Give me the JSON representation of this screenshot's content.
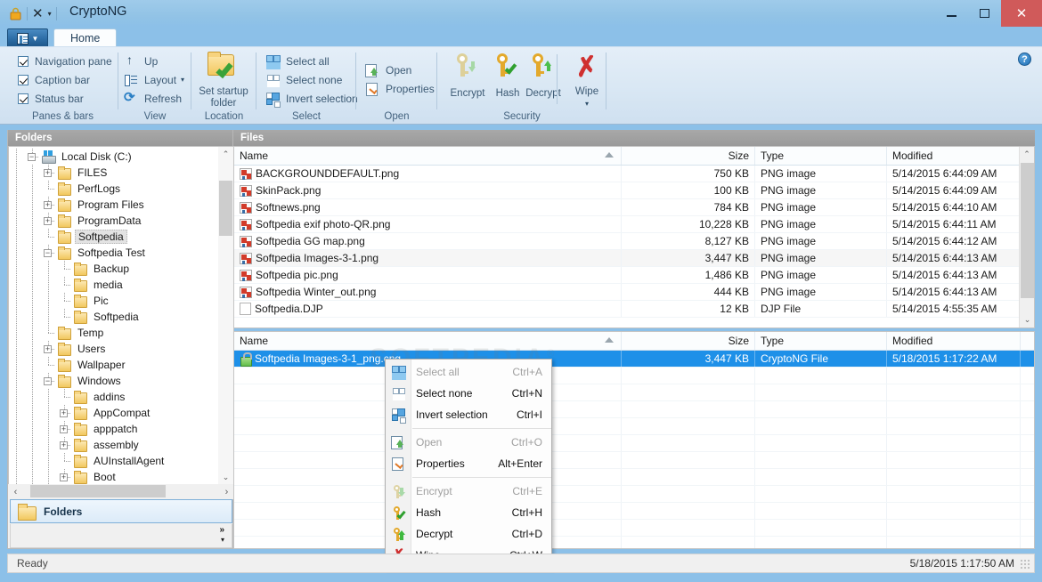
{
  "window": {
    "title": "CryptoNG",
    "qat": {
      "lock_icon": "lock-icon",
      "close_icon": "close-icon",
      "caret": "▾"
    },
    "buttons": {
      "minimize": "minimize-button",
      "maximize": "maximize-button",
      "close": "✕"
    }
  },
  "ribbon": {
    "app_button": "app-menu-button",
    "tab": "Home",
    "help": "?",
    "groups": [
      {
        "label": "Panes & bars"
      },
      {
        "label": "View"
      },
      {
        "label": "Location"
      },
      {
        "label": "Select"
      },
      {
        "label": "Open"
      },
      {
        "label": "Security"
      }
    ],
    "panes_bars": [
      {
        "label": "Navigation pane",
        "checked": true
      },
      {
        "label": "Caption bar",
        "checked": true
      },
      {
        "label": "Status bar",
        "checked": true
      }
    ],
    "view": [
      {
        "label": "Up",
        "icon": "arrow-up-icon"
      },
      {
        "label": "Layout",
        "icon": "layout-icon",
        "caret": "▾"
      },
      {
        "label": "Refresh",
        "icon": "refresh-icon"
      }
    ],
    "location": {
      "label_line1": "Set startup",
      "label_line2": "folder",
      "icon": "folder-check-icon"
    },
    "select": [
      {
        "label": "Select all",
        "icon": "select-all-icon"
      },
      {
        "label": "Select none",
        "icon": "select-none-icon"
      },
      {
        "label": "Invert selection",
        "icon": "invert-selection-icon"
      }
    ],
    "open": [
      {
        "label": "Open",
        "icon": "open-file-icon"
      },
      {
        "label": "Properties",
        "icon": "properties-icon"
      }
    ],
    "security": [
      {
        "label": "Encrypt",
        "icon": "key-down-icon"
      },
      {
        "label": "Hash",
        "icon": "key-check-icon"
      },
      {
        "label": "Decrypt",
        "icon": "key-up-icon"
      },
      {
        "label": "Wipe",
        "icon": "red-x-icon",
        "caret": "▾"
      }
    ]
  },
  "folders_pane": {
    "header": "Folders",
    "tree": [
      {
        "label": "Local Disk (C:)",
        "depth": 2,
        "expander": "minus",
        "icon": "drive-icon",
        "selected": false
      },
      {
        "label": "FILES",
        "depth": 3,
        "expander": "plus",
        "icon": "folder-icon",
        "selected": false
      },
      {
        "label": "PerfLogs",
        "depth": 3,
        "expander": "none",
        "icon": "folder-icon",
        "selected": false
      },
      {
        "label": "Program Files",
        "depth": 3,
        "expander": "plus",
        "icon": "folder-icon",
        "selected": false
      },
      {
        "label": "ProgramData",
        "depth": 3,
        "expander": "plus",
        "icon": "folder-icon",
        "selected": false
      },
      {
        "label": "Softpedia",
        "depth": 3,
        "expander": "none",
        "icon": "folder-icon",
        "selected": true
      },
      {
        "label": "Softpedia Test",
        "depth": 3,
        "expander": "minus",
        "icon": "folder-icon",
        "selected": false
      },
      {
        "label": "Backup",
        "depth": 4,
        "expander": "none",
        "icon": "folder-icon",
        "selected": false
      },
      {
        "label": "media",
        "depth": 4,
        "expander": "none",
        "icon": "folder-icon",
        "selected": false
      },
      {
        "label": "Pic",
        "depth": 4,
        "expander": "none",
        "icon": "folder-icon",
        "selected": false
      },
      {
        "label": "Softpedia",
        "depth": 4,
        "expander": "none",
        "icon": "folder-icon",
        "selected": false
      },
      {
        "label": "Temp",
        "depth": 3,
        "expander": "none",
        "icon": "folder-icon",
        "selected": false
      },
      {
        "label": "Users",
        "depth": 3,
        "expander": "plus",
        "icon": "folder-icon",
        "selected": false
      },
      {
        "label": "Wallpaper",
        "depth": 3,
        "expander": "none",
        "icon": "folder-icon",
        "selected": false
      },
      {
        "label": "Windows",
        "depth": 3,
        "expander": "minus",
        "icon": "folder-icon",
        "selected": false
      },
      {
        "label": "addins",
        "depth": 4,
        "expander": "none",
        "icon": "folder-icon",
        "selected": false
      },
      {
        "label": "AppCompat",
        "depth": 4,
        "expander": "plus",
        "icon": "folder-icon",
        "selected": false
      },
      {
        "label": "apppatch",
        "depth": 4,
        "expander": "plus",
        "icon": "folder-icon",
        "selected": false
      },
      {
        "label": "assembly",
        "depth": 4,
        "expander": "plus",
        "icon": "folder-icon",
        "selected": false
      },
      {
        "label": "AUInstallAgent",
        "depth": 4,
        "expander": "none",
        "icon": "folder-icon",
        "selected": false
      },
      {
        "label": "Boot",
        "depth": 4,
        "expander": "plus",
        "icon": "folder-icon",
        "selected": false
      }
    ],
    "folders_button": "Folders",
    "overflow_chevron": "»",
    "overflow_caret": "▾",
    "hscroll_left": "‹",
    "hscroll_right": "›"
  },
  "files_pane": {
    "header": "Files",
    "columns": [
      "Name",
      "Size",
      "Type",
      "Modified"
    ],
    "sorted_by": "Name",
    "sort_direction": "ascending",
    "rows": [
      {
        "name": "BACKGROUNDDEFAULT.png",
        "size": "750 KB",
        "type": "PNG image",
        "modified": "5/14/2015 6:44:09 AM",
        "icon": "png-file-icon"
      },
      {
        "name": "SkinPack.png",
        "size": "100 KB",
        "type": "PNG image",
        "modified": "5/14/2015 6:44:09 AM",
        "icon": "png-file-icon"
      },
      {
        "name": "Softnews.png",
        "size": "784 KB",
        "type": "PNG image",
        "modified": "5/14/2015 6:44:10 AM",
        "icon": "png-file-icon"
      },
      {
        "name": "Softpedia exif photo-QR.png",
        "size": "10,228 KB",
        "type": "PNG image",
        "modified": "5/14/2015 6:44:11 AM",
        "icon": "png-file-icon"
      },
      {
        "name": "Softpedia GG map.png",
        "size": "8,127 KB",
        "type": "PNG image",
        "modified": "5/14/2015 6:44:12 AM",
        "icon": "png-file-icon"
      },
      {
        "name": "Softpedia Images-3-1.png",
        "size": "3,447 KB",
        "type": "PNG image",
        "modified": "5/14/2015 6:44:13 AM",
        "icon": "png-file-icon",
        "highlight": true
      },
      {
        "name": "Softpedia pic.png",
        "size": "1,486 KB",
        "type": "PNG image",
        "modified": "5/14/2015 6:44:13 AM",
        "icon": "png-file-icon"
      },
      {
        "name": "Softpedia Winter_out.png",
        "size": "444 KB",
        "type": "PNG image",
        "modified": "5/14/2015 6:44:13 AM",
        "icon": "png-file-icon"
      },
      {
        "name": "Softpedia.DJP",
        "size": "12 KB",
        "type": "DJP File",
        "modified": "5/14/2015 4:55:35 AM",
        "icon": "blank-file-icon"
      }
    ]
  },
  "output_pane": {
    "columns": [
      "Name",
      "Size",
      "Type",
      "Modified"
    ],
    "rows": [
      {
        "name": "Softpedia Images-3-1_png.cng",
        "size": "3,447 KB",
        "type": "CryptoNG File",
        "modified": "5/18/2015 1:17:22 AM",
        "icon": "lock-file-icon",
        "selected": true
      }
    ]
  },
  "context_menu": {
    "items": [
      {
        "label": "Select all",
        "accel": "Ctrl+A",
        "icon": "select-all-icon",
        "disabled": true
      },
      {
        "label": "Select none",
        "accel": "Ctrl+N",
        "icon": "select-none-icon",
        "disabled": false
      },
      {
        "label": "Invert  selection",
        "accel": "Ctrl+I",
        "icon": "invert-selection-icon",
        "disabled": false
      },
      {
        "separator": true
      },
      {
        "label": "Open",
        "accel": "Ctrl+O",
        "icon": "open-file-icon",
        "disabled": true
      },
      {
        "label": "Properties",
        "accel": "Alt+Enter",
        "icon": "properties-icon",
        "disabled": false
      },
      {
        "separator": true
      },
      {
        "label": "Encrypt",
        "accel": "Ctrl+E",
        "icon": "key-down-icon",
        "disabled": true
      },
      {
        "label": "Hash",
        "accel": "Ctrl+H",
        "icon": "key-check-icon",
        "disabled": false
      },
      {
        "label": "Decrypt",
        "accel": "Ctrl+D",
        "icon": "key-up-icon",
        "disabled": false
      },
      {
        "label": "Wipe",
        "accel": "Ctrl+W",
        "icon": "red-x-icon",
        "disabled": false
      }
    ]
  },
  "statusbar": {
    "left": "Ready",
    "right": "5/18/2015 1:17:50 AM"
  },
  "watermark": "SOFTPEDIA",
  "colors": {
    "titlebar": "#8cc0e8",
    "close_button": "#d05a5a",
    "selection": "#1e90e8",
    "pane_header": "#a0a0a0",
    "ribbon_text": "#3c5a74"
  }
}
